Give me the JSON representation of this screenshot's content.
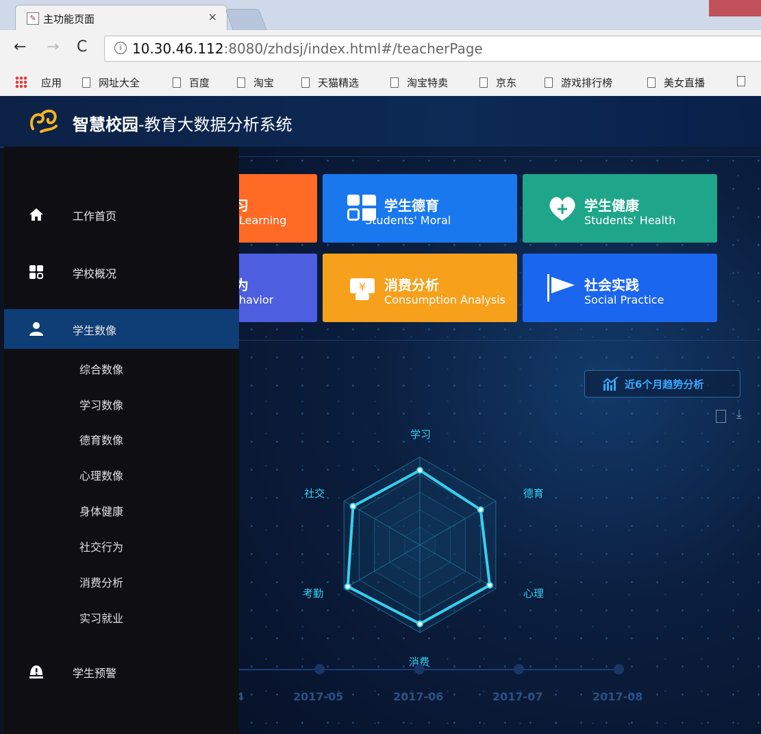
{
  "browser": {
    "tab_title": "主功能页面",
    "tab_close": "×",
    "url_prefix": "10.30.46.112",
    "url_rest": ":8080/zhdsj/index.html#/teacherPage",
    "nav": {
      "back": "←",
      "forward": "→",
      "reload": "C"
    },
    "bookmarks": [
      "应用",
      "网址大全",
      "百度",
      "淘宝",
      "天猫精选",
      "淘宝特卖",
      "京东",
      "游戏排行榜",
      "美女直播"
    ]
  },
  "app": {
    "title_bold": "智慧校园",
    "title_rest": "-教育大数据分析系统"
  },
  "sidebar": {
    "items": [
      {
        "label": "工作首页",
        "icon": "home-icon"
      },
      {
        "label": "学校概况",
        "icon": "grid-icon"
      },
      {
        "label": "学生数像",
        "icon": "user-icon",
        "active": true
      },
      {
        "label": "学生预警",
        "icon": "warning-icon"
      }
    ],
    "subitems": [
      "综合数像",
      "学习数像",
      "德育数像",
      "心理数像",
      "身体健康",
      "社交行为",
      "消费分析",
      "实习就业"
    ]
  },
  "cards": [
    {
      "title": "",
      "title_partial": "习",
      "subtitle": "Learning",
      "color": "#ff6a25"
    },
    {
      "title": "学生德育",
      "subtitle": "Students' Moral",
      "color": "#1a78ee"
    },
    {
      "title": "学生健康",
      "subtitle": "Students' Health",
      "color": "#1fa58a"
    },
    {
      "title_partial": "为",
      "subtitle": "havior",
      "color": "#4e5ee0"
    },
    {
      "title": "消费分析",
      "subtitle": "Consumption Analysis",
      "color": "#f7a01c"
    },
    {
      "title": "社会实践",
      "subtitle": "Social Practice",
      "color": "#1b66ee"
    }
  ],
  "trend_button": "近6个月趋势分析",
  "chart_data": {
    "type": "radar",
    "indicators": [
      "学习",
      "德育",
      "心理",
      "消费",
      "考勤",
      "社交"
    ],
    "values": [
      0.85,
      0.8,
      0.92,
      0.9,
      0.95,
      0.88
    ],
    "max": 1
  },
  "timeline": {
    "labels": [
      "4",
      "2017-05",
      "2017-06",
      "2017-07",
      "2017-08"
    ]
  },
  "colors": {
    "sidebar_bg": "#0e0e13",
    "active_menu": "#0f3d76",
    "header_bg": "#0c2a55",
    "radar_line": "#36d0ee"
  }
}
